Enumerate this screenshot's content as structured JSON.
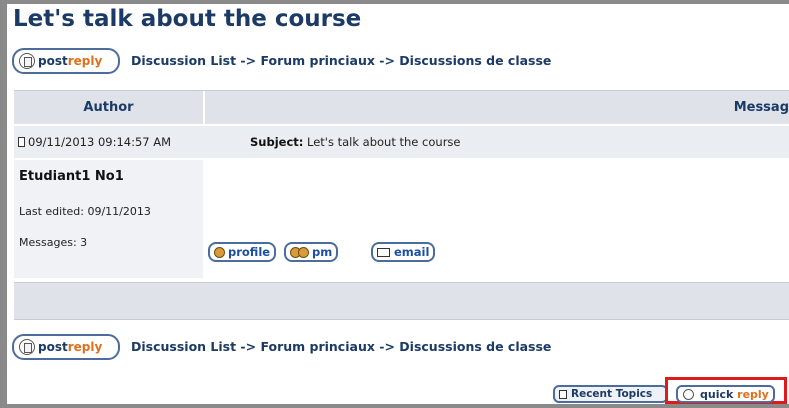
{
  "page": {
    "title": "Let's talk about the course"
  },
  "reply_button": {
    "label_prefix": "post",
    "label_suffix": "reply"
  },
  "breadcrumb": {
    "items": [
      "Discussion List",
      "Forum princiaux",
      "Discussions de classe"
    ],
    "separator": " -> "
  },
  "table": {
    "headers": {
      "author": "Author",
      "message": "Messag"
    }
  },
  "post": {
    "timestamp": "09/11/2013 09:14:57 AM",
    "subject_label": "Subject:",
    "subject_value": " Let's talk about the course",
    "author": "Etudiant1 No1",
    "last_edited": "Last edited: 09/11/2013",
    "messages": "Messages: 3",
    "actions": {
      "profile": "profile",
      "pm": "pm",
      "email": "email"
    }
  },
  "footer": {
    "recent_topics": "Recent Topics",
    "quick_reply_prefix": "quick",
    "quick_reply_suffix": "reply"
  },
  "colors": {
    "title": "#1b3a66",
    "accent": "#e0701b",
    "highlight_border": "#e01a1a"
  }
}
